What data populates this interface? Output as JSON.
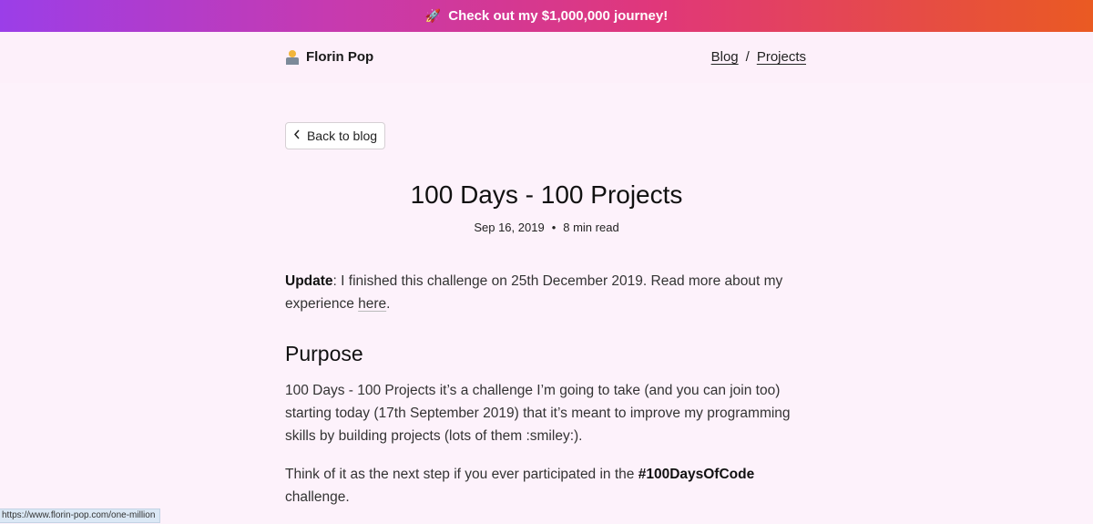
{
  "banner": {
    "icon": "rocket-icon",
    "icon_glyph": "🚀",
    "text": "Check out my $1,000,000 journey!"
  },
  "header": {
    "brand": "Florin Pop",
    "nav": [
      {
        "label": "Blog"
      },
      {
        "label": "Projects"
      }
    ],
    "separator": "/"
  },
  "back_button": {
    "label": "Back to blog",
    "icon": "chevron-left-icon",
    "glyph": "‹"
  },
  "post": {
    "title": "100 Days - 100 Projects",
    "date": "Sep 16, 2019",
    "dot": "•",
    "read_time": "8 min read"
  },
  "content": {
    "update_label": "Update",
    "update_text_1": ": I finished this challenge on 25th December 2019. Read more about my experience ",
    "update_link": "here",
    "update_text_2": ".",
    "purpose_heading": "Purpose",
    "purpose_p1": "100 Days - 100 Projects it’s a challenge I’m going to take (and you can join too) starting today (17th September 2019) that it’s meant to improve my programming skills by building projects (lots of them :smiley:).",
    "purpose_p2_1": "Think of it as the next step if you ever participated in the ",
    "purpose_p2_tag": "#100DaysOfCode",
    "purpose_p2_2": " challenge."
  },
  "status_url": "https://www.florin-pop.com/one-million",
  "colors": {
    "page_bg": "#fdf2fb",
    "banner_gradient": [
      "#9b3ee8",
      "#c63ab0",
      "#e0377a",
      "#ea5a22"
    ]
  }
}
